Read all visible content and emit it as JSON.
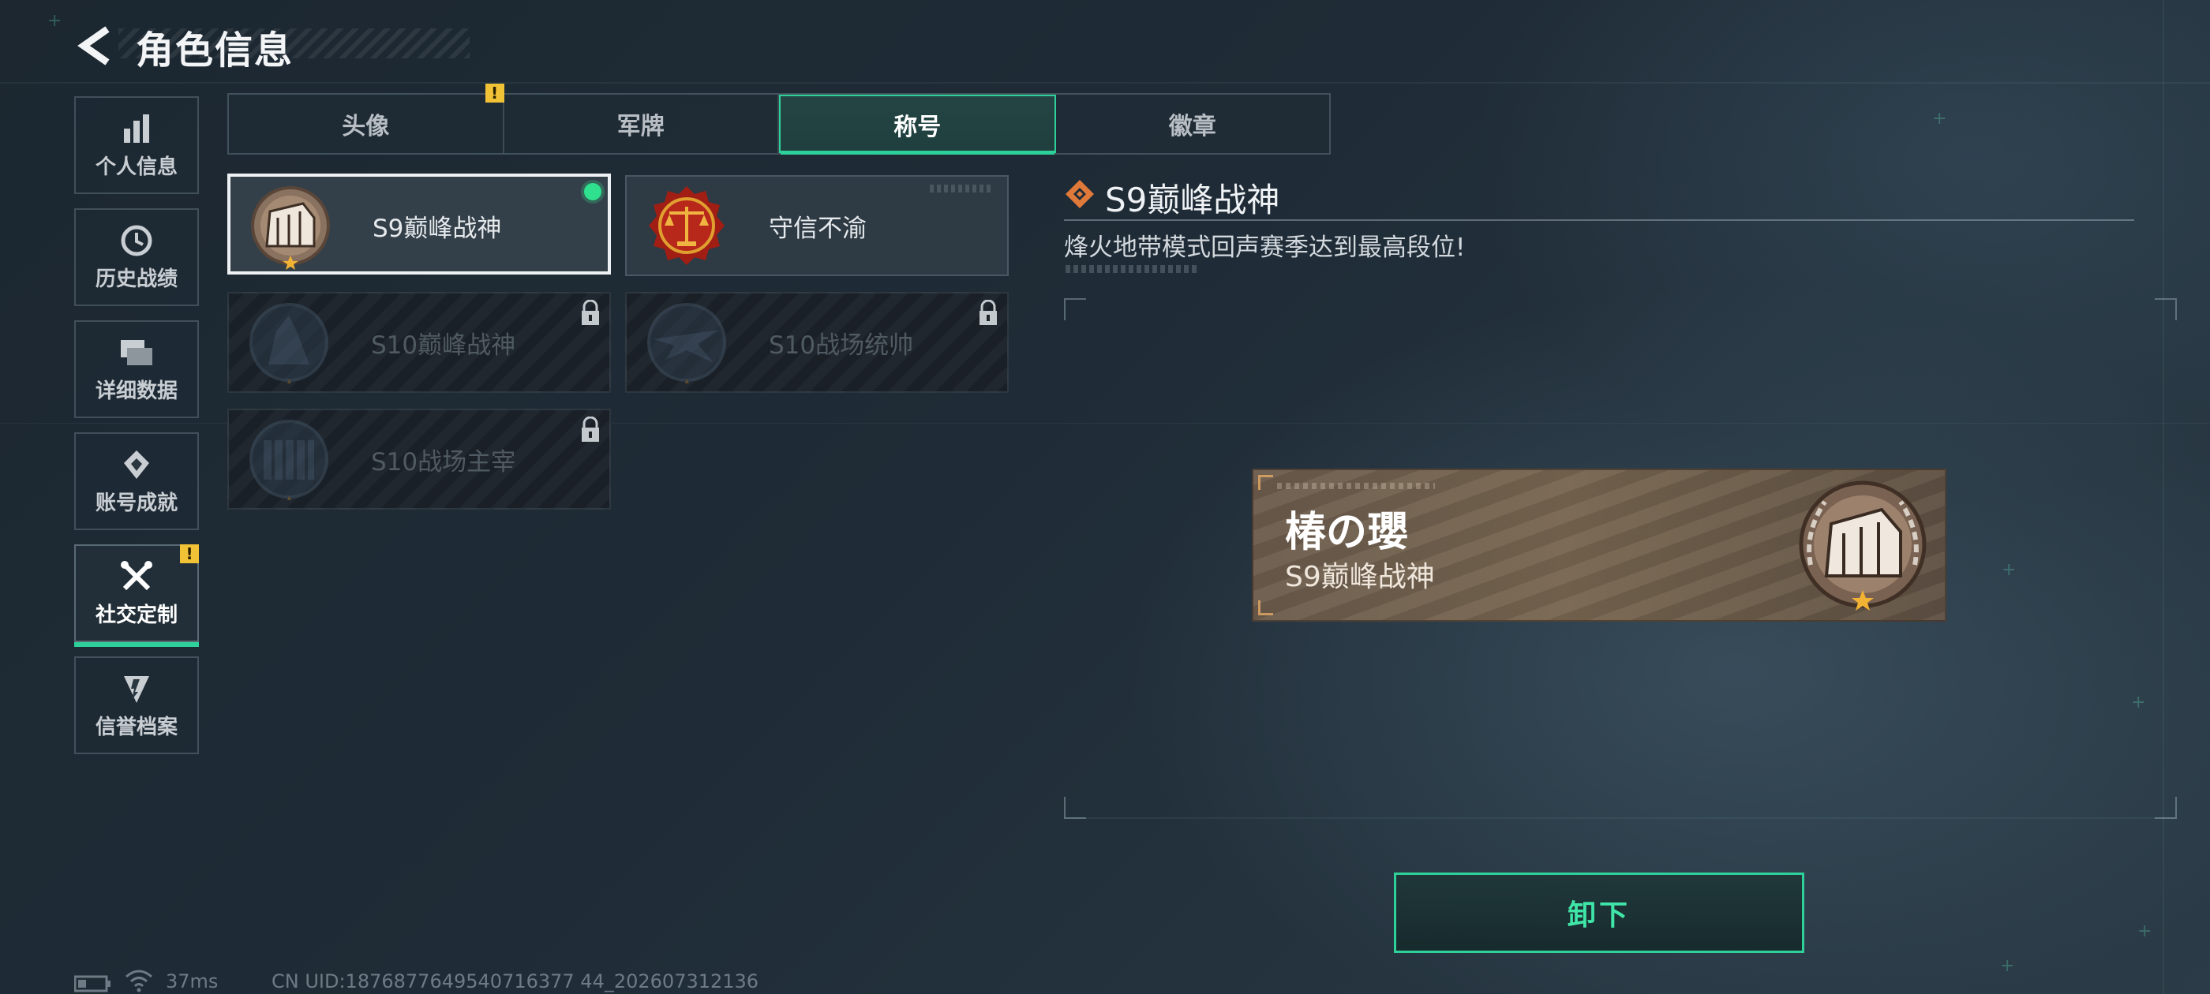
{
  "header": {
    "title": "角色信息"
  },
  "sidebar": {
    "items": [
      {
        "label": "个人信息",
        "icon": "bar-chart-icon",
        "active": false
      },
      {
        "label": "历史战绩",
        "icon": "history-clock-icon",
        "active": false
      },
      {
        "label": "详细数据",
        "icon": "folder-stack-icon",
        "active": false
      },
      {
        "label": "账号成就",
        "icon": "achievement-icon",
        "active": false
      },
      {
        "label": "社交定制",
        "icon": "tools-icon",
        "active": true,
        "alert": "!"
      },
      {
        "label": "信誉档案",
        "icon": "shield-icon",
        "active": false
      }
    ]
  },
  "tabs": [
    {
      "label": "头像",
      "active": false,
      "alert": "!"
    },
    {
      "label": "军牌",
      "active": false
    },
    {
      "label": "称号",
      "active": true
    },
    {
      "label": "徽章",
      "active": false
    }
  ],
  "titles": [
    {
      "name": "S9巅峰战神",
      "state": "equipped",
      "badge": "fortress-laurel-badge"
    },
    {
      "name": "守信不渝",
      "state": "owned",
      "badge": "scales-badge"
    },
    {
      "name": "S10巅峰战神",
      "state": "locked",
      "badge": "tower-laurel-badge"
    },
    {
      "name": "S10战场统帅",
      "state": "locked",
      "badge": "aircraft-laurel-badge"
    },
    {
      "name": "S10战场主宰",
      "state": "locked",
      "badge": "colosseum-laurel-badge"
    }
  ],
  "detail": {
    "title": "S9巅峰战神",
    "description": "烽火地带模式回声赛季达到最高段位!"
  },
  "nameplate": {
    "player_name": "椿の瓔",
    "title": "S9巅峰战神"
  },
  "actions": {
    "unequip_label": "卸下"
  },
  "status": {
    "ping": "37ms",
    "uid": "CN UID:1876877649540716377 44_202607312136"
  },
  "colors": {
    "accent": "#2fd19a",
    "alert": "#f2c236",
    "equipped": "#2fe08f",
    "title_diamond": "#e07a3a"
  }
}
